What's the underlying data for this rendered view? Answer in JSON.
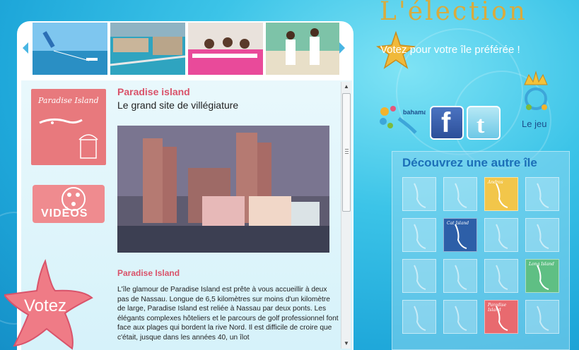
{
  "header": {
    "title": "L'élection",
    "vote_banner": "Votez pour votre île préférée !"
  },
  "gallery": {
    "prev_label": "◀",
    "next_label": "▶"
  },
  "article": {
    "title": "Paradise island",
    "subtitle": "Le grand site de villégiature",
    "section_title": "Paradise Island",
    "body": "L'île glamour de Paradise Island est prête à vous accueillir à deux pas de Nassau. Longue de 6,5 kilomètres sur moins d'un kilomètre de large, Paradise Island est reliée à Nassau par deux ponts. Les élégants complexes hôteliers et le parcours de golf professionnel font face aux plages qui bordent la rive Nord. Il est difficile de croire que c'était, jusque dans les années 40, un îlot"
  },
  "sidebar": {
    "card_paradise_label": "Paradise Island",
    "videos_label": "VIDÉOS",
    "votez_label": "Votez"
  },
  "social": {
    "bahamas_label": "bahamas",
    "facebook_label": "f",
    "le_jeu_label": "Le jeu"
  },
  "discover": {
    "title": "Découvrez une autre île",
    "tiles": [
      {
        "label": "",
        "active": false
      },
      {
        "label": "",
        "active": false
      },
      {
        "label": "Andros",
        "active": true
      },
      {
        "label": "",
        "active": false
      },
      {
        "label": "",
        "active": false
      },
      {
        "label": "Cat Island",
        "active": true
      },
      {
        "label": "",
        "active": false
      },
      {
        "label": "",
        "active": false
      },
      {
        "label": "",
        "active": false
      },
      {
        "label": "",
        "active": false
      },
      {
        "label": "",
        "active": false
      },
      {
        "label": "Long Island",
        "active": true
      },
      {
        "label": "",
        "active": false
      },
      {
        "label": "",
        "active": false
      },
      {
        "label": "Paradise Island",
        "active": true
      },
      {
        "label": "",
        "active": false
      }
    ]
  },
  "colors": {
    "accent_pink": "#d9536a",
    "gold": "#d9ab3d",
    "discover_blue": "#1c6fb8"
  }
}
